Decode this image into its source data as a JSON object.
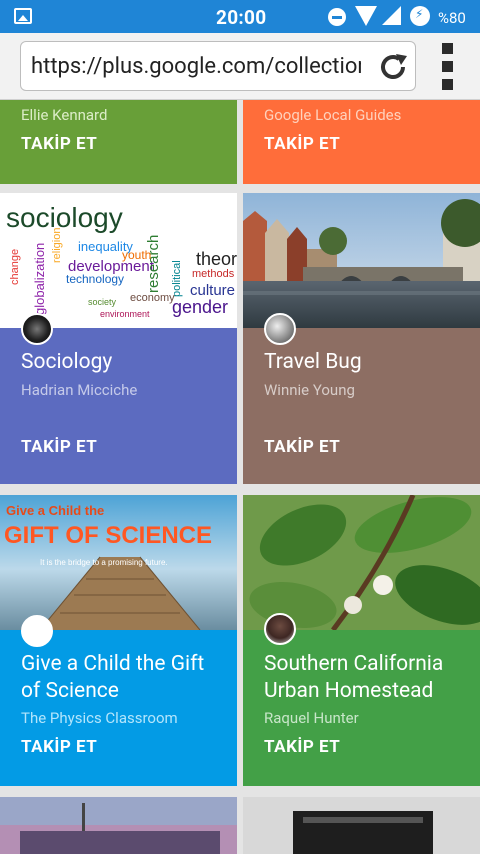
{
  "status_bar": {
    "time": "20:00",
    "battery": "%80"
  },
  "browser": {
    "url": "https://plus.google.com/collections/featured"
  },
  "cards": [
    {
      "id": "ellie",
      "subtitle": "Ellie Kennard",
      "follow": "TAKİP ET",
      "color": "#689f38"
    },
    {
      "id": "guides",
      "subtitle": "Google Local Guides",
      "follow": "TAKİP ET",
      "color": "#ff6d3a"
    },
    {
      "id": "sociology",
      "title": "Sociology",
      "subtitle": "Hadrian Micciche",
      "follow": "TAKİP ET",
      "color": "#5c6bc0",
      "image_words": [
        "sociology",
        "change",
        "inequality",
        "development",
        "research",
        "theor",
        "youth",
        "technology",
        "globalization",
        "culture",
        "gender",
        "methods",
        "political",
        "religion",
        "economy"
      ]
    },
    {
      "id": "travel",
      "title": "Travel Bug",
      "subtitle": "Winnie Young",
      "follow": "TAKİP ET",
      "color": "#8d6e63"
    },
    {
      "id": "science",
      "title": "Give a Child the Gift of Science",
      "subtitle": "The Physics Classroom",
      "follow": "TAKİP ET",
      "color": "#039be5",
      "image_text": {
        "line1": "Give a Child the",
        "line2": "GIFT OF SCIENCE",
        "line3": "It is the bridge to a promising future."
      }
    },
    {
      "id": "homestead",
      "title": "Southern California Urban Homestead",
      "subtitle": "Raquel Hunter",
      "follow": "TAKİP ET",
      "color": "#43a047"
    }
  ]
}
